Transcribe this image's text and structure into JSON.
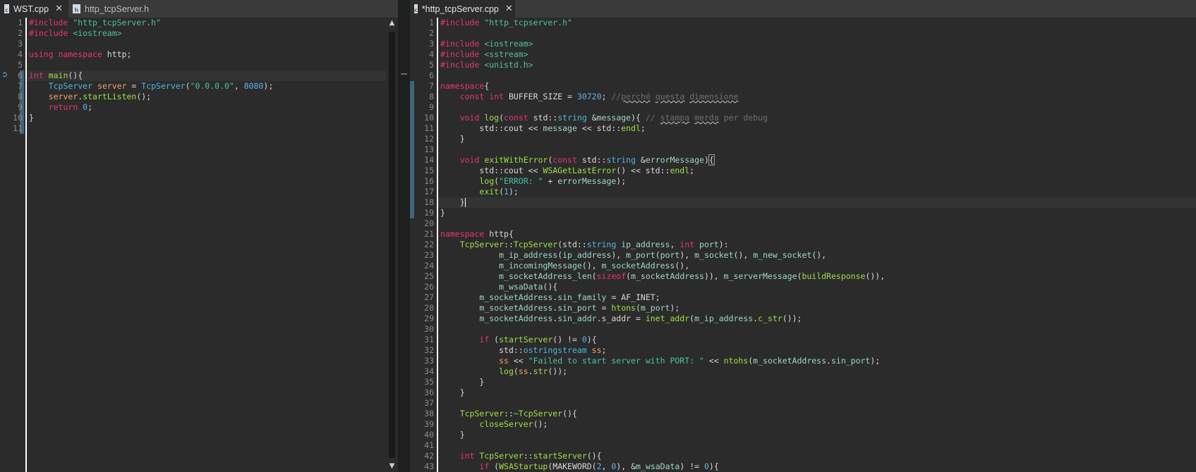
{
  "left_editor": {
    "tabs": [
      {
        "label": "WST.cpp",
        "icon": "cpp-file-icon",
        "active": true,
        "close": "✕"
      },
      {
        "label": "http_tcpServer.h",
        "icon": "header-file-icon",
        "active": false
      }
    ],
    "line_numbers": [
      "1",
      "2",
      "3",
      "4",
      "5",
      "6",
      "7",
      "8",
      "9",
      "10",
      "11"
    ],
    "code": [
      [
        [
          "k",
          "#include "
        ],
        [
          "s",
          "\"http_tcpServer.h\""
        ]
      ],
      [
        [
          "k",
          "#include "
        ],
        [
          "s",
          "<iostream>"
        ]
      ],
      [],
      [
        [
          "k",
          "using namespace "
        ],
        [
          "p",
          "http;"
        ]
      ],
      [],
      [
        [
          "k",
          "int "
        ],
        [
          "f",
          "main"
        ],
        [
          "p",
          "(){"
        ]
      ],
      [
        [
          "p",
          "    "
        ],
        [
          "t",
          "TcpServer "
        ],
        [
          "v",
          "server"
        ],
        [
          "p",
          " = "
        ],
        [
          "t",
          "TcpServer"
        ],
        [
          "p",
          "("
        ],
        [
          "s",
          "\"0.0.0.0\""
        ],
        [
          "p",
          ", "
        ],
        [
          "n",
          "8080"
        ],
        [
          "p",
          ");"
        ]
      ],
      [
        [
          "p",
          "    "
        ],
        [
          "v",
          "server"
        ],
        [
          "p",
          "."
        ],
        [
          "f",
          "startListen"
        ],
        [
          "p",
          "();"
        ]
      ],
      [
        [
          "p",
          "    "
        ],
        [
          "k",
          "return "
        ],
        [
          "n",
          "0"
        ],
        [
          "p",
          ";"
        ]
      ],
      [
        [
          "p",
          "}"
        ]
      ],
      []
    ]
  },
  "right_editor": {
    "tabs": [
      {
        "label": "*http_tcpServer.cpp",
        "icon": "cpp-file-icon",
        "active": true,
        "close": "✕"
      }
    ],
    "line_numbers": [
      "1",
      "2",
      "3",
      "4",
      "5",
      "6",
      "7",
      "8",
      "9",
      "10",
      "11",
      "12",
      "13",
      "14",
      "15",
      "16",
      "17",
      "18",
      "19",
      "20",
      "21",
      "22",
      "23",
      "24",
      "25",
      "26",
      "27",
      "28",
      "29",
      "30",
      "31",
      "32",
      "33",
      "34",
      "35",
      "36",
      "37",
      "38",
      "39",
      "40",
      "41",
      "42",
      "43"
    ],
    "code": [
      [
        [
          "k",
          "#include "
        ],
        [
          "s",
          "\"http_tcpserver.h\""
        ]
      ],
      [],
      [
        [
          "k",
          "#include "
        ],
        [
          "s",
          "<iostream>"
        ]
      ],
      [
        [
          "k",
          "#include "
        ],
        [
          "s",
          "<sstream>"
        ]
      ],
      [
        [
          "k",
          "#include "
        ],
        [
          "s",
          "<unistd.h>"
        ]
      ],
      [],
      [
        [
          "k",
          "namespace"
        ],
        [
          "p",
          "{"
        ]
      ],
      [
        [
          "p",
          "    "
        ],
        [
          "k",
          "const int "
        ],
        [
          "p",
          "BUFFER_SIZE = "
        ],
        [
          "n",
          "30720"
        ],
        [
          "p",
          "; "
        ],
        [
          "c",
          "//"
        ],
        [
          "csq",
          "perché"
        ],
        [
          "c",
          " "
        ],
        [
          "csq",
          "questa"
        ],
        [
          "c",
          " "
        ],
        [
          "csq",
          "dimensione"
        ]
      ],
      [],
      [
        [
          "p",
          "    "
        ],
        [
          "k",
          "void "
        ],
        [
          "f",
          "log"
        ],
        [
          "p",
          "("
        ],
        [
          "k",
          "const "
        ],
        [
          "p",
          "std::"
        ],
        [
          "t",
          "string "
        ],
        [
          "p",
          "&"
        ],
        [
          "m",
          "message"
        ],
        [
          "p",
          "){ "
        ],
        [
          "c",
          "// "
        ],
        [
          "csq",
          "stampa"
        ],
        [
          "c",
          " "
        ],
        [
          "csq",
          "merda"
        ],
        [
          "c",
          " per debug"
        ]
      ],
      [
        [
          "p",
          "        std::cout << "
        ],
        [
          "m",
          "message"
        ],
        [
          "p",
          " << std::"
        ],
        [
          "f",
          "endl"
        ],
        [
          "p",
          ";"
        ]
      ],
      [
        [
          "p",
          "    }"
        ]
      ],
      [],
      [
        [
          "p",
          "    "
        ],
        [
          "k",
          "void "
        ],
        [
          "f",
          "exitWithError"
        ],
        [
          "p",
          "("
        ],
        [
          "k",
          "const "
        ],
        [
          "p",
          "std::"
        ],
        [
          "t",
          "string "
        ],
        [
          "p",
          "&"
        ],
        [
          "m",
          "errorMessage"
        ],
        [
          "p",
          ")"
        ],
        [
          "box",
          "{"
        ]
      ],
      [
        [
          "p",
          "        std::cout << "
        ],
        [
          "f",
          "WSAGetLastError"
        ],
        [
          "p",
          "() << std::"
        ],
        [
          "f",
          "endl"
        ],
        [
          "p",
          ";"
        ]
      ],
      [
        [
          "p",
          "        "
        ],
        [
          "f",
          "log"
        ],
        [
          "p",
          "("
        ],
        [
          "s",
          "\"ERROR: \""
        ],
        [
          "p",
          " + "
        ],
        [
          "m",
          "errorMessage"
        ],
        [
          "p",
          ");"
        ]
      ],
      [
        [
          "p",
          "        "
        ],
        [
          "f",
          "exit"
        ],
        [
          "p",
          "("
        ],
        [
          "n",
          "1"
        ],
        [
          "p",
          ");"
        ]
      ],
      [
        [
          "p",
          "    }"
        ],
        [
          "caret",
          ""
        ]
      ],
      [
        [
          "p",
          "}"
        ]
      ],
      [],
      [
        [
          "k",
          "namespace "
        ],
        [
          "p",
          "http{"
        ]
      ],
      [
        [
          "p",
          "    "
        ],
        [
          "f",
          "TcpServer"
        ],
        [
          "p",
          "::"
        ],
        [
          "f",
          "TcpServer"
        ],
        [
          "p",
          "(std::"
        ],
        [
          "t",
          "string "
        ],
        [
          "m",
          "ip_address"
        ],
        [
          "p",
          ", "
        ],
        [
          "k",
          "int "
        ],
        [
          "m",
          "port"
        ],
        [
          "p",
          "):"
        ]
      ],
      [
        [
          "p",
          "            "
        ],
        [
          "m",
          "m_ip_address"
        ],
        [
          "p",
          "("
        ],
        [
          "m",
          "ip_address"
        ],
        [
          "p",
          "), "
        ],
        [
          "m",
          "m_port"
        ],
        [
          "p",
          "("
        ],
        [
          "m",
          "port"
        ],
        [
          "p",
          "), "
        ],
        [
          "m",
          "m_socket"
        ],
        [
          "p",
          "(), "
        ],
        [
          "m",
          "m_new_socket"
        ],
        [
          "p",
          "(),"
        ]
      ],
      [
        [
          "p",
          "            "
        ],
        [
          "m",
          "m_incomingMessage"
        ],
        [
          "p",
          "(), "
        ],
        [
          "m",
          "m_socketAddress"
        ],
        [
          "p",
          "(),"
        ]
      ],
      [
        [
          "p",
          "            "
        ],
        [
          "m",
          "m_socketAddress_len"
        ],
        [
          "p",
          "("
        ],
        [
          "k",
          "sizeof"
        ],
        [
          "p",
          "("
        ],
        [
          "m",
          "m_socketAddress"
        ],
        [
          "p",
          ")), "
        ],
        [
          "m",
          "m_serverMessage"
        ],
        [
          "p",
          "("
        ],
        [
          "f",
          "buildResponse"
        ],
        [
          "p",
          "()),"
        ]
      ],
      [
        [
          "p",
          "            "
        ],
        [
          "m",
          "m_wsaData"
        ],
        [
          "p",
          "(){"
        ]
      ],
      [
        [
          "p",
          "        "
        ],
        [
          "m",
          "m_socketAddress"
        ],
        [
          "p",
          "."
        ],
        [
          "m",
          "sin_family"
        ],
        [
          "p",
          " = AF_INET;"
        ]
      ],
      [
        [
          "p",
          "        "
        ],
        [
          "m",
          "m_socketAddress"
        ],
        [
          "p",
          "."
        ],
        [
          "m",
          "sin_port"
        ],
        [
          "p",
          " = "
        ],
        [
          "f",
          "htons"
        ],
        [
          "p",
          "("
        ],
        [
          "m",
          "m_port"
        ],
        [
          "p",
          ");"
        ]
      ],
      [
        [
          "p",
          "        "
        ],
        [
          "m",
          "m_socketAddress"
        ],
        [
          "p",
          "."
        ],
        [
          "m",
          "sin_addr"
        ],
        [
          "p",
          ".s_addr = "
        ],
        [
          "f",
          "inet_addr"
        ],
        [
          "p",
          "("
        ],
        [
          "m",
          "m_ip_address"
        ],
        [
          "p",
          "."
        ],
        [
          "f",
          "c_str"
        ],
        [
          "p",
          "());"
        ]
      ],
      [],
      [
        [
          "p",
          "        "
        ],
        [
          "k",
          "if "
        ],
        [
          "p",
          "("
        ],
        [
          "f",
          "startServer"
        ],
        [
          "p",
          "() != "
        ],
        [
          "n",
          "0"
        ],
        [
          "p",
          "){"
        ]
      ],
      [
        [
          "p",
          "            std::"
        ],
        [
          "t",
          "ostringstream "
        ],
        [
          "v",
          "ss"
        ],
        [
          "p",
          ";"
        ]
      ],
      [
        [
          "p",
          "            "
        ],
        [
          "v",
          "ss"
        ],
        [
          "p",
          " << "
        ],
        [
          "s",
          "\"Failed to start server with PORT: \""
        ],
        [
          "p",
          " << "
        ],
        [
          "f",
          "ntohs"
        ],
        [
          "p",
          "("
        ],
        [
          "m",
          "m_socketAddress"
        ],
        [
          "p",
          "."
        ],
        [
          "m",
          "sin_port"
        ],
        [
          "p",
          ");"
        ]
      ],
      [
        [
          "p",
          "            "
        ],
        [
          "f",
          "log"
        ],
        [
          "p",
          "("
        ],
        [
          "v",
          "ss"
        ],
        [
          "p",
          "."
        ],
        [
          "f",
          "str"
        ],
        [
          "p",
          "());"
        ]
      ],
      [
        [
          "p",
          "        }"
        ]
      ],
      [
        [
          "p",
          "    }"
        ]
      ],
      [],
      [
        [
          "p",
          "    "
        ],
        [
          "f",
          "TcpServer"
        ],
        [
          "p",
          "::"
        ],
        [
          "f",
          "~TcpServer"
        ],
        [
          "p",
          "(){"
        ]
      ],
      [
        [
          "p",
          "        "
        ],
        [
          "f",
          "closeServer"
        ],
        [
          "p",
          "();"
        ]
      ],
      [
        [
          "p",
          "    }"
        ]
      ],
      [],
      [
        [
          "p",
          "    "
        ],
        [
          "k",
          "int "
        ],
        [
          "f",
          "TcpServer"
        ],
        [
          "p",
          "::"
        ],
        [
          "f",
          "startServer"
        ],
        [
          "p",
          "(){"
        ]
      ],
      [
        [
          "p",
          "        "
        ],
        [
          "k",
          "if "
        ],
        [
          "p",
          "("
        ],
        [
          "f",
          "WSAStartup"
        ],
        [
          "p",
          "(MAKEWORD("
        ],
        [
          "n",
          "2"
        ],
        [
          "p",
          ", "
        ],
        [
          "n",
          "0"
        ],
        [
          "p",
          "), &"
        ],
        [
          "m",
          "m_wsaData"
        ],
        [
          "p",
          ") != "
        ],
        [
          "n",
          "0"
        ],
        [
          "p",
          "){"
        ]
      ]
    ]
  },
  "scroll_arrows": {
    "up": "▲",
    "down": "▼"
  },
  "debug_marker": "➲"
}
